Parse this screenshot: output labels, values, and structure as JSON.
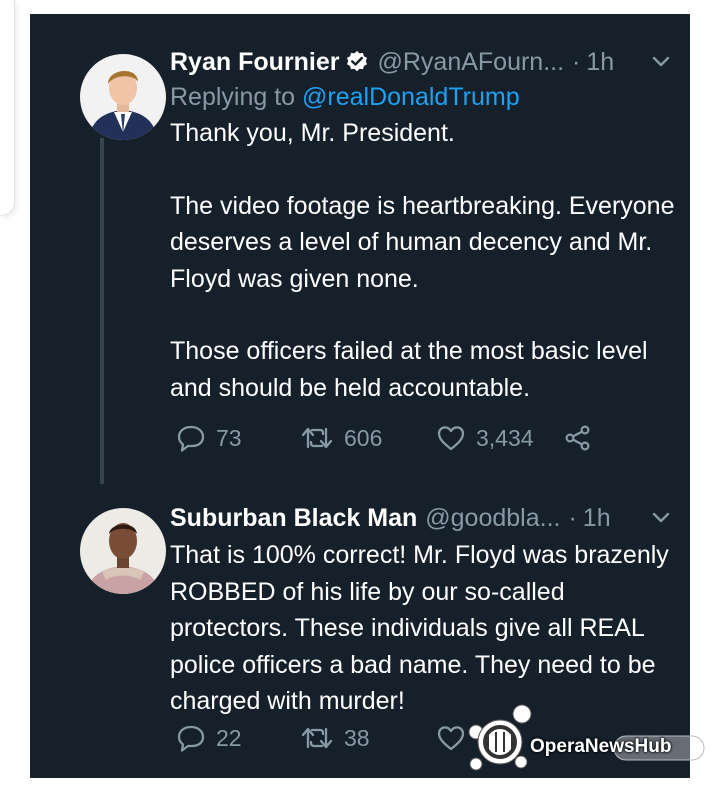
{
  "tweets": [
    {
      "display_name": "Ryan Fournier",
      "verified": true,
      "handle": "@RyanAFourn...",
      "separator": "·",
      "time": "1h",
      "replying_prefix": "Replying to",
      "replying_to": "@realDonaldTrump",
      "body": [
        "Thank you, Mr. President.",
        "The video footage is heartbreaking. Everyone deserves a level of human decency and Mr. Floyd was given none.",
        "Those officers failed at the most basic level and should be held accountable."
      ],
      "replies": "73",
      "retweets": "606",
      "likes": "3,434"
    },
    {
      "display_name": "Suburban Black Man",
      "handle": "@goodbla...",
      "separator": "·",
      "time": "1h",
      "body": [
        "That is 100% correct! Mr. Floyd was brazenly ROBBED of his life by our so-called protectors. These individuals give all REAL police officers a bad name. They need to be charged with murder!"
      ],
      "replies": "22",
      "retweets": "38"
    }
  ],
  "watermark": {
    "brand": "OperaNews",
    "suffix": "Hub"
  },
  "colors": {
    "background": "#15202b",
    "primary_text": "#ffffff",
    "secondary_text": "#8899a6",
    "link": "#1da1f2",
    "thread_line": "#38444d"
  }
}
